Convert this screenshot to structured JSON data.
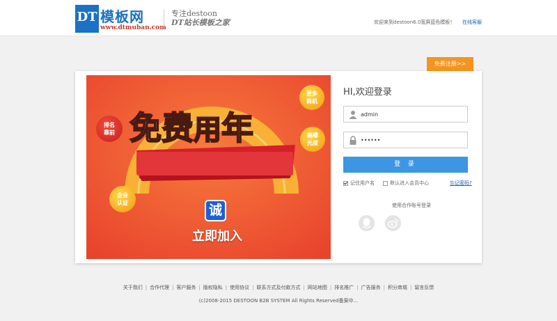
{
  "header": {
    "logo_mark": "DT",
    "logo_name": "模板网",
    "logo_url": "www.dtmuban.com",
    "slogan_line1": "专注destoon",
    "slogan_line2": "DT站长模板之家",
    "welcome": "欢迎来到destoon6.0宽屏蓝色模板！",
    "service_link": "在线客服"
  },
  "register_button": "免费注册>>",
  "banner": {
    "headline_1": "免费",
    "headline_2": "用",
    "headline_3": "年",
    "bubble_1": [
      "更多",
      "商机"
    ],
    "bubble_2": [
      "排名",
      "靠前"
    ],
    "bubble_3": [
      "高曝",
      "光度"
    ],
    "bubble_4": [
      "企业",
      "认证"
    ],
    "badge": "诚",
    "cta": "立即加入"
  },
  "login": {
    "title": "HI,欢迎登录",
    "username": "admin",
    "password": "••••••",
    "submit": "登 录",
    "remember": "记住用户名",
    "member_center": "默认进入会员中心",
    "forgot": "忘记密码?",
    "partner_title": "使用合作账号登录"
  },
  "footer": {
    "links": [
      "关于我们",
      "合作代理",
      "客户服务",
      "版权隐私",
      "使用协议",
      "联系方式及付款方式",
      "网站地图",
      "排名推广",
      "广告服务",
      "积分商城",
      "留言反馈"
    ],
    "copyright": "(c)2008-2015 DESTOON B2B SYSTEM All Rights Reserved备案中..."
  },
  "colors": {
    "brand_blue": "#1a71c6",
    "login_button": "#3c96e4",
    "register_orange": "#f7941d",
    "banner_red": "#e8432d"
  }
}
